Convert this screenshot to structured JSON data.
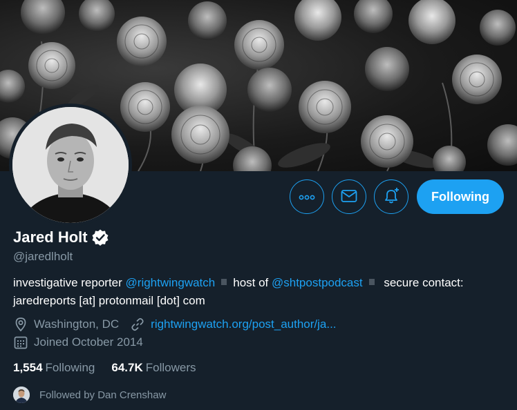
{
  "profile": {
    "name": "Jared Holt",
    "handle": "@jaredlholt",
    "bio": {
      "part1": "investigative reporter ",
      "mention1": "@rightwingwatch",
      "part2": "host of ",
      "mention2": "@shtpostpodcast",
      "part3": "secure contact: jaredreports [at] protonmail [dot] com"
    },
    "location": "Washington, DC",
    "website": "rightwingwatch.org/post_author/ja...",
    "joined": "Joined October 2014"
  },
  "stats": {
    "following_count": "1,554",
    "following_label": "Following",
    "followers_count": "64.7K",
    "followers_label": "Followers"
  },
  "followed_by": "Followed by Dan Crenshaw",
  "actions": {
    "following_button": "Following"
  },
  "colors": {
    "background": "#15202b",
    "accent": "#1da1f2",
    "secondary_text": "#8899a6"
  },
  "icons": {
    "more": "more-icon",
    "mail": "mail-icon",
    "notify": "bell-plus-icon",
    "verified": "verified-badge-icon",
    "location": "location-pin-icon",
    "link": "link-icon",
    "calendar": "calendar-icon"
  }
}
